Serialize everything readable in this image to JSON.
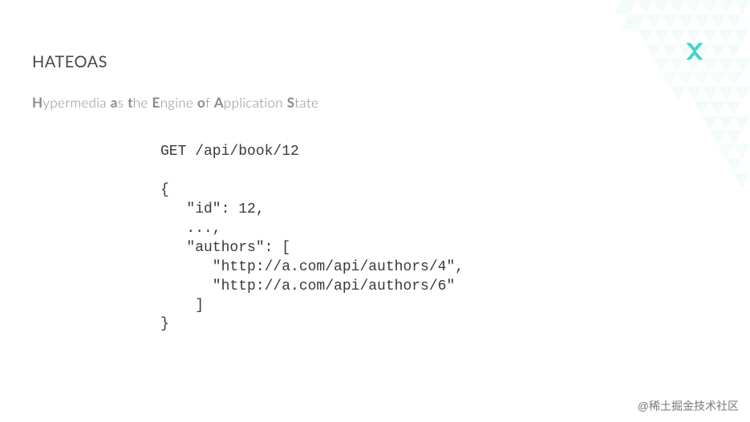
{
  "title": "HATEOAS",
  "subtitle_parts": {
    "h": "H",
    "r1": "ypermedia ",
    "a": "a",
    "r2": "s ",
    "t": "t",
    "r3": "he ",
    "e": "E",
    "r4": "ngine ",
    "o": "o",
    "r5": "f ",
    "ap": "A",
    "r6": "pplication ",
    "s": "S",
    "r7": "tate"
  },
  "code": "GET /api/book/12\n\n{\n   \"id\": 12,\n   ...,\n   \"authors\": [\n      \"http://a.com/api/authors/4\",\n      \"http://a.com/api/authors/6\"\n    ]\n}",
  "watermark": "@稀土掘金技术社区",
  "colors": {
    "accent": "#3fd6c8"
  }
}
